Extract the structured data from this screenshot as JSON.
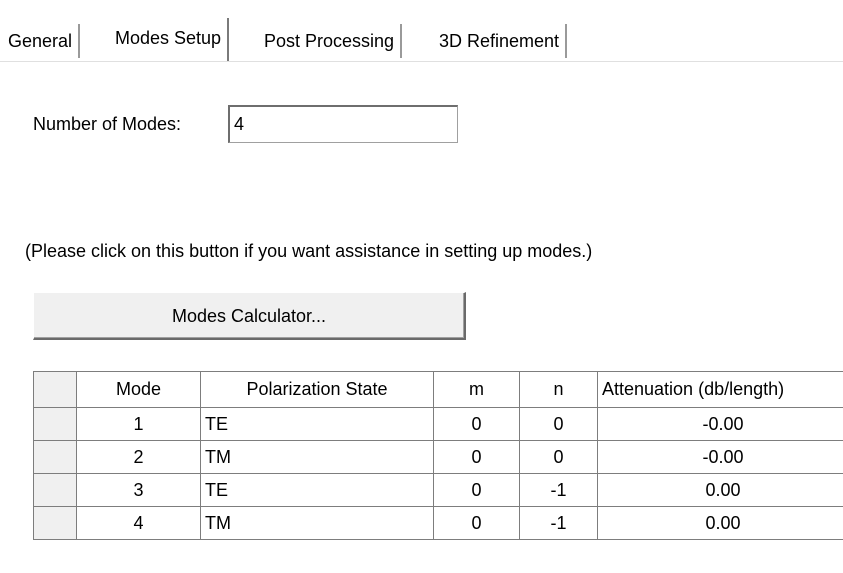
{
  "tabs": [
    {
      "label": "General",
      "active": false
    },
    {
      "label": "Modes Setup",
      "active": true
    },
    {
      "label": "Post Processing",
      "active": false
    },
    {
      "label": "3D Refinement",
      "active": false
    }
  ],
  "modes": {
    "label": "Number of Modes:",
    "value": "4"
  },
  "help_text": "(Please click on this button if you want assistance in setting up modes.)",
  "calculator_button": "Modes Calculator...",
  "table": {
    "headers": [
      "Mode",
      "Polarization State",
      "m",
      "n",
      "Attenuation (db/length)"
    ],
    "rows": [
      {
        "mode": "1",
        "polarization": "TE",
        "m": "0",
        "n": "0",
        "attenuation": "-0.00"
      },
      {
        "mode": "2",
        "polarization": "TM",
        "m": "0",
        "n": "0",
        "attenuation": "-0.00"
      },
      {
        "mode": "3",
        "polarization": "TE",
        "m": "0",
        "n": "-1",
        "attenuation": "0.00"
      },
      {
        "mode": "4",
        "polarization": "TM",
        "m": "0",
        "n": "-1",
        "attenuation": "0.00"
      }
    ]
  }
}
